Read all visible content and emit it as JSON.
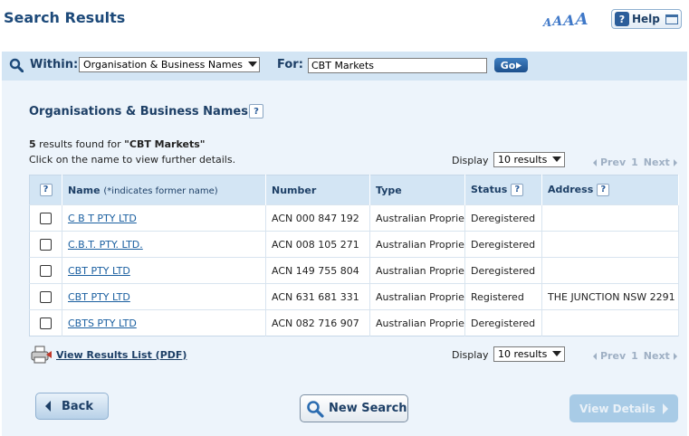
{
  "page": {
    "title": "Search Results"
  },
  "header": {
    "font_size_glyphs": [
      "A",
      "A",
      "A",
      "A"
    ],
    "help_label": "Help",
    "help_badge": "?"
  },
  "search": {
    "within_label": "Within:",
    "within_value": "Organisation & Business Names",
    "for_label": "For:",
    "for_value": "CBT Markets",
    "go_label": "Go"
  },
  "section": {
    "title": "Organisations & Business Names",
    "help_badge": "?"
  },
  "results": {
    "count": "5",
    "found_text": "results found for",
    "query": "\"CBT Markets\"",
    "hint": "Click on the name to view further details.",
    "display_label": "Display",
    "display_value": "10 results",
    "pager": {
      "prev": "Prev",
      "page": "1",
      "next": "Next"
    }
  },
  "table": {
    "headers": {
      "help_badge": "?",
      "name": "Name",
      "name_note": "(*indicates former name)",
      "number": "Number",
      "type": "Type",
      "status": "Status",
      "address": "Address"
    },
    "rows": [
      {
        "name": "C B T PTY LTD",
        "number": "ACN 000 847 192",
        "type": "Australian Proprietary Company",
        "status": "Deregistered",
        "address": ""
      },
      {
        "name": "C.B.T. PTY. LTD.",
        "number": "ACN 008 105 271",
        "type": "Australian Proprietary Company",
        "status": "Deregistered",
        "address": ""
      },
      {
        "name": "CBT PTY LTD",
        "number": "ACN 149 755 804",
        "type": "Australian Proprietary Company",
        "status": "Deregistered",
        "address": ""
      },
      {
        "name": "CBT PTY LTD",
        "number": "ACN 631 681 331",
        "type": "Australian Proprietary Company",
        "status": "Registered",
        "address": "THE JUNCTION NSW 2291"
      },
      {
        "name": "CBTS PTY LTD",
        "number": "ACN 082 716 907",
        "type": "Australian Proprietary Company",
        "status": "Deregistered",
        "address": ""
      }
    ]
  },
  "footer": {
    "pdf_label": "View Results List (PDF)",
    "display_label": "Display",
    "display_value": "10 results",
    "pager": {
      "prev": "Prev",
      "page": "1",
      "next": "Next"
    },
    "back_label": "Back",
    "new_search_label": "New Search",
    "view_details_label": "View Details"
  },
  "colors": {
    "title": "#1d4a7a",
    "panel_bg": "#edf4fb",
    "bar_bg": "#d3e5f4",
    "link": "#1a5fa0",
    "disabled_button": "#a8cbe6"
  }
}
